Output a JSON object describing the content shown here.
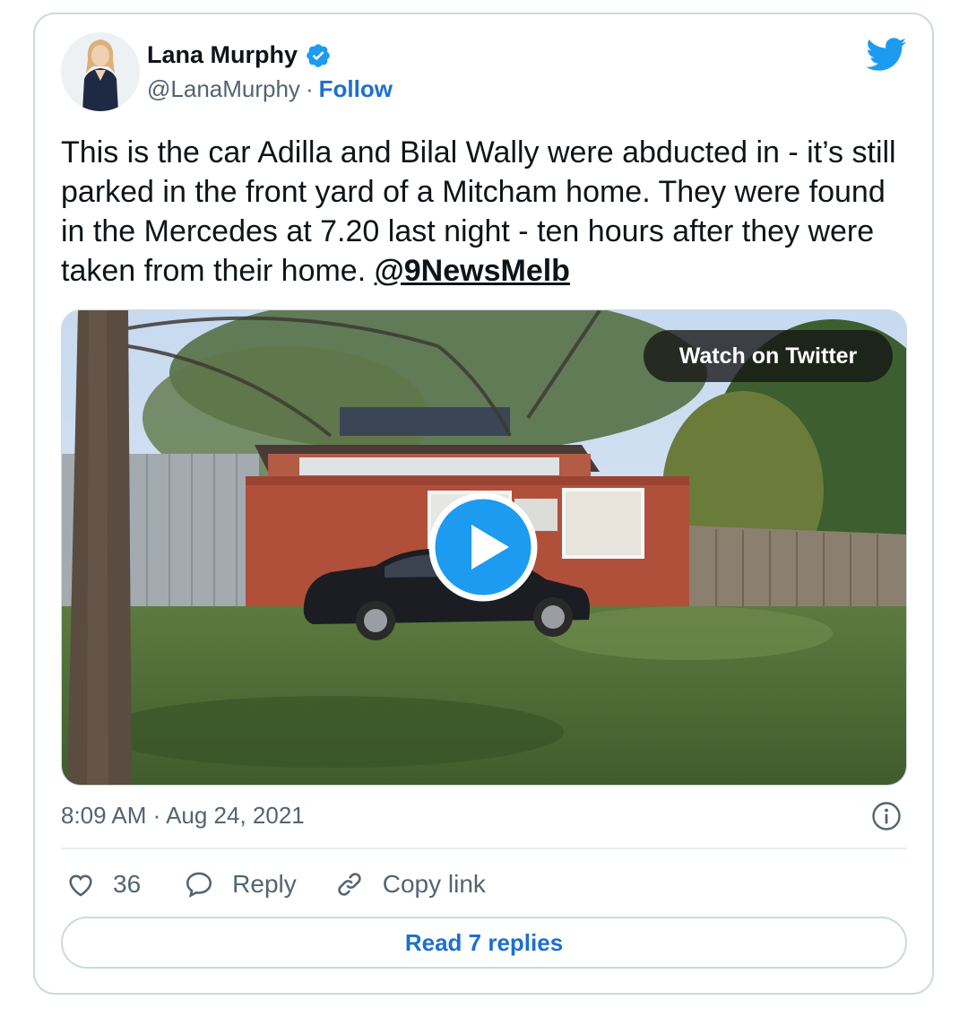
{
  "author": {
    "name": "Lana Murphy",
    "handle": "@LanaMurphy",
    "separator": "·",
    "follow_label": "Follow"
  },
  "tweet": {
    "text": "This is the car Adilla and Bilal Wally were abducted in - it’s still parked in the front yard of a Mitcham home. They were found in the Mercedes at 7.20 last night - ten hours after they were taken from their home. ",
    "mention": "@9NewsMelb"
  },
  "media": {
    "watch_label": "Watch on Twitter"
  },
  "timestamp": "8:09 AM · Aug 24, 2021",
  "actions": {
    "likes_count": "36",
    "reply_label": "Reply",
    "copy_link_label": "Copy link"
  },
  "read_replies_label": "Read 7 replies",
  "icons": {
    "logo": "twitter-bird-icon",
    "verified": "verified-badge-icon",
    "play": "play-icon",
    "info": "info-icon",
    "like": "heart-icon",
    "reply": "speech-bubble-icon",
    "copy_link": "link-icon"
  },
  "colors": {
    "twitter_blue": "#1d9bf0",
    "link_blue": "#1d6fce",
    "text": "#0f1419",
    "secondary_text": "#536471",
    "border": "#cfd9de"
  }
}
